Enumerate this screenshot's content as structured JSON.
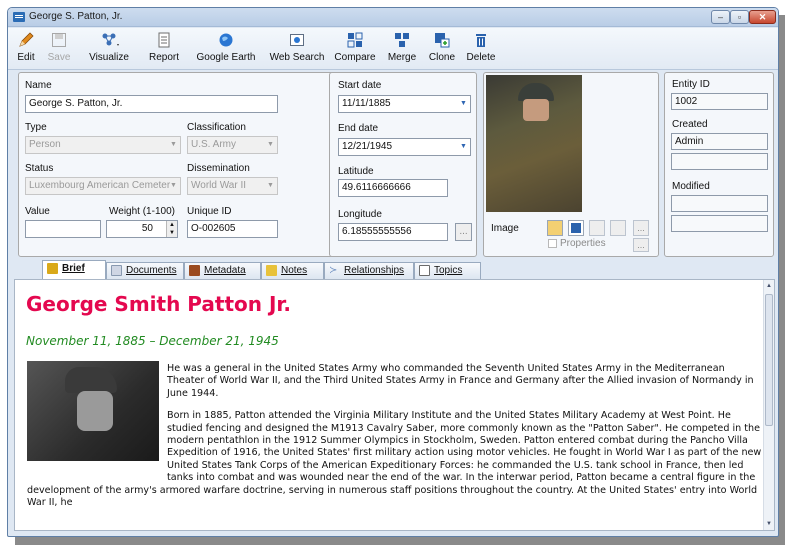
{
  "window": {
    "title": "George S. Patton, Jr."
  },
  "toolbar": [
    {
      "label": "Edit",
      "icon": "pencil-icon"
    },
    {
      "label": "Save",
      "icon": "save-icon"
    },
    {
      "label": "Visualize",
      "icon": "visualize-icon"
    },
    {
      "label": "Report",
      "icon": "report-icon"
    },
    {
      "label": "Google Earth",
      "icon": "globe-icon"
    },
    {
      "label": "Web Search",
      "icon": "web-search-icon"
    },
    {
      "label": "Compare",
      "icon": "compare-icon"
    },
    {
      "label": "Merge",
      "icon": "merge-icon"
    },
    {
      "label": "Clone",
      "icon": "clone-icon"
    },
    {
      "label": "Delete",
      "icon": "trash-icon"
    }
  ],
  "form": {
    "name_label": "Name",
    "name_value": "George S. Patton, Jr.",
    "type_label": "Type",
    "type_value": "Person",
    "classification_label": "Classification",
    "classification_value": "U.S. Army",
    "status_label": "Status",
    "status_value": "Luxembourg American Cemeter",
    "dissemination_label": "Dissemination",
    "dissemination_value": "World War II",
    "value_label": "Value",
    "value_value": "",
    "weight_label": "Weight (1-100)",
    "weight_value": "50",
    "uid_label": "Unique ID",
    "uid_value": "O-002605"
  },
  "dates": {
    "start_label": "Start date",
    "start_value": "11/11/1885",
    "end_label": "End date",
    "end_value": "12/21/1945",
    "lat_label": "Latitude",
    "lat_value": "49.6116666666",
    "lon_label": "Longitude",
    "lon_value": "6.18555555556",
    "ellipsis": "..."
  },
  "image_panel": {
    "image_label": "Image",
    "properties_label": "Properties",
    "ellipsis": "..."
  },
  "meta": {
    "entity_id_label": "Entity ID",
    "entity_id_value": "1002",
    "created_label": "Created",
    "created_value": "Admin",
    "created_date": "",
    "modified_label": "Modified",
    "modified_value": "",
    "modified_date": ""
  },
  "tabs": [
    {
      "label": "Brief",
      "active": true,
      "color": "#d9a91a"
    },
    {
      "label": "Documents",
      "active": false,
      "color": "#cfd6e4"
    },
    {
      "label": "Metadata",
      "active": false,
      "color": "#9b4b20"
    },
    {
      "label": "Notes",
      "active": false,
      "color": "#e8c23a"
    },
    {
      "label": "Relationships",
      "active": false,
      "color": "#6a8cbf"
    },
    {
      "label": "Topics",
      "active": false,
      "color": "#6b6b6b"
    }
  ],
  "brief": {
    "title": "George Smith Patton Jr.",
    "dates": "November 11, 1885 – December 21, 1945",
    "p1": "He was a general in the United States Army who commanded the Seventh United States Army in the Mediterranean Theater of World War II, and the Third United States Army in France and Germany after the Allied invasion of Normandy in June 1944.",
    "p2": "Born in 1885, Patton attended the Virginia Military Institute and the United States Military Academy at West Point. He studied fencing and designed the M1913 Cavalry Saber, more commonly known as the \"Patton Saber\". He competed in the modern pentathlon in the 1912 Summer Olympics in Stockholm, Sweden. Patton entered combat during the Pancho Villa Expedition of 1916, the United States' first military action using motor vehicles. He fought in World War I as part of the new United States Tank Corps of the American Expeditionary Forces: he commanded the U.S. tank school in France, then led tanks into combat and was wounded near the end of the war. In the interwar period, Patton became a central figure in the development of the army's armored warfare doctrine, serving in numerous staff positions throughout the country. At the United States' entry into World War II, he"
  },
  "colors": {
    "title": "#e4084f",
    "dates": "#228b22",
    "accent": "#2f66b3"
  }
}
